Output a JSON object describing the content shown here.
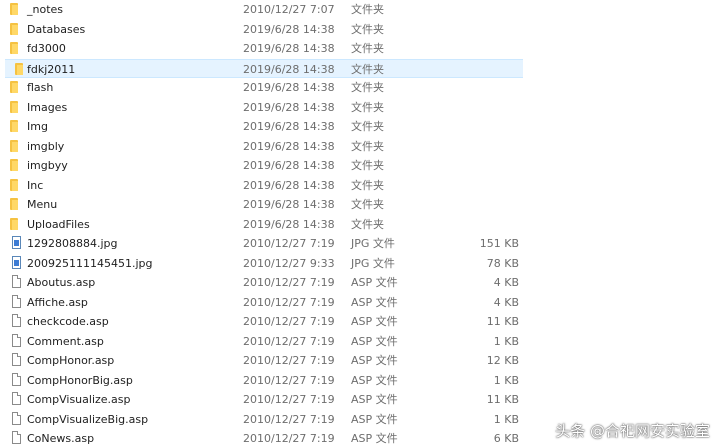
{
  "files": [
    {
      "name": "_notes",
      "date": "2010/12/27 7:07",
      "type": "文件夹",
      "size": "",
      "icon": "folder-icon",
      "selected": false
    },
    {
      "name": "Databases",
      "date": "2019/6/28 14:38",
      "type": "文件夹",
      "size": "",
      "icon": "folder-icon",
      "selected": false
    },
    {
      "name": "fd3000",
      "date": "2019/6/28 14:38",
      "type": "文件夹",
      "size": "",
      "icon": "folder-icon",
      "selected": false
    },
    {
      "name": "fdkj2011",
      "date": "2019/6/28 14:38",
      "type": "文件夹",
      "size": "",
      "icon": "folder-icon",
      "selected": true
    },
    {
      "name": "flash",
      "date": "2019/6/28 14:38",
      "type": "文件夹",
      "size": "",
      "icon": "folder-icon",
      "selected": false
    },
    {
      "name": "Images",
      "date": "2019/6/28 14:38",
      "type": "文件夹",
      "size": "",
      "icon": "folder-icon",
      "selected": false
    },
    {
      "name": "Img",
      "date": "2019/6/28 14:38",
      "type": "文件夹",
      "size": "",
      "icon": "folder-icon",
      "selected": false
    },
    {
      "name": "imgbly",
      "date": "2019/6/28 14:38",
      "type": "文件夹",
      "size": "",
      "icon": "folder-icon",
      "selected": false
    },
    {
      "name": "imgbyy",
      "date": "2019/6/28 14:38",
      "type": "文件夹",
      "size": "",
      "icon": "folder-icon",
      "selected": false
    },
    {
      "name": "Inc",
      "date": "2019/6/28 14:38",
      "type": "文件夹",
      "size": "",
      "icon": "folder-icon",
      "selected": false
    },
    {
      "name": "Menu",
      "date": "2019/6/28 14:38",
      "type": "文件夹",
      "size": "",
      "icon": "folder-icon",
      "selected": false
    },
    {
      "name": "UploadFiles",
      "date": "2019/6/28 14:38",
      "type": "文件夹",
      "size": "",
      "icon": "folder-icon",
      "selected": false
    },
    {
      "name": "1292808884.jpg",
      "date": "2010/12/27 7:19",
      "type": "JPG 文件",
      "size": "151 KB",
      "icon": "image-file-icon",
      "selected": false
    },
    {
      "name": "200925111145451.jpg",
      "date": "2010/12/27 9:33",
      "type": "JPG 文件",
      "size": "78 KB",
      "icon": "image-file-icon",
      "selected": false
    },
    {
      "name": "Aboutus.asp",
      "date": "2010/12/27 7:19",
      "type": "ASP 文件",
      "size": "4 KB",
      "icon": "file-icon",
      "selected": false
    },
    {
      "name": "Affiche.asp",
      "date": "2010/12/27 7:19",
      "type": "ASP 文件",
      "size": "4 KB",
      "icon": "file-icon",
      "selected": false
    },
    {
      "name": "checkcode.asp",
      "date": "2010/12/27 7:19",
      "type": "ASP 文件",
      "size": "11 KB",
      "icon": "file-icon",
      "selected": false
    },
    {
      "name": "Comment.asp",
      "date": "2010/12/27 7:19",
      "type": "ASP 文件",
      "size": "1 KB",
      "icon": "file-icon",
      "selected": false
    },
    {
      "name": "CompHonor.asp",
      "date": "2010/12/27 7:19",
      "type": "ASP 文件",
      "size": "12 KB",
      "icon": "file-icon",
      "selected": false
    },
    {
      "name": "CompHonorBig.asp",
      "date": "2010/12/27 7:19",
      "type": "ASP 文件",
      "size": "1 KB",
      "icon": "file-icon",
      "selected": false
    },
    {
      "name": "CompVisualize.asp",
      "date": "2010/12/27 7:19",
      "type": "ASP 文件",
      "size": "11 KB",
      "icon": "file-icon",
      "selected": false
    },
    {
      "name": "CompVisualizeBig.asp",
      "date": "2010/12/27 7:19",
      "type": "ASP 文件",
      "size": "1 KB",
      "icon": "file-icon",
      "selected": false
    },
    {
      "name": "CoNews.asp",
      "date": "2010/12/27 7:19",
      "type": "ASP 文件",
      "size": "6 KB",
      "icon": "file-icon",
      "selected": false
    }
  ],
  "watermark": "头条 @合祀网安实验室",
  "colors": {
    "selection_bg": "#e5f3ff",
    "selection_border": "#cce8ff",
    "folder": "#ffd867",
    "text_primary": "#1e1e1e",
    "text_secondary": "#6d6d6d"
  }
}
